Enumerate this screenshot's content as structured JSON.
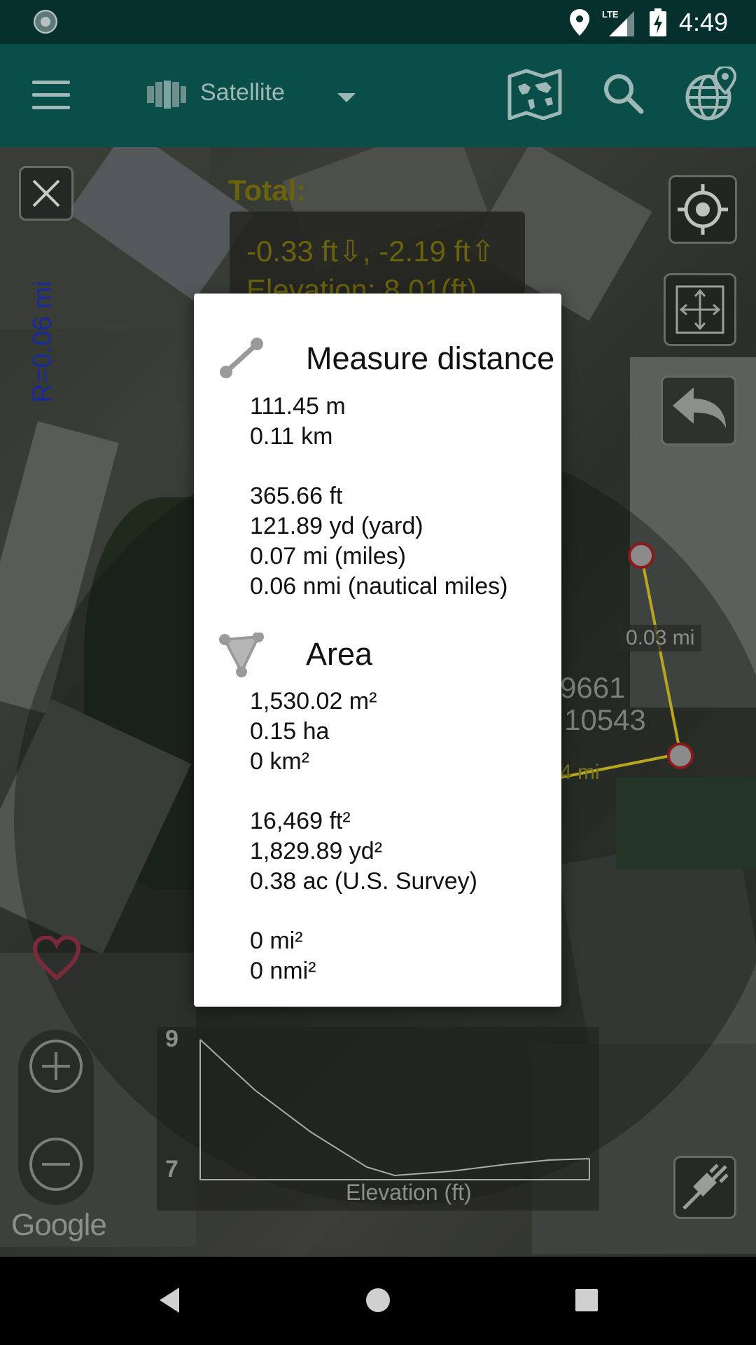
{
  "status_bar": {
    "time": "4:49",
    "network": "LTE",
    "icons": [
      "app-notification-icon",
      "location-icon",
      "signal-icon",
      "battery-charging-icon"
    ]
  },
  "app_bar": {
    "map_type": "Satellite",
    "icons": [
      "menu-icon",
      "layers-icon",
      "world-map-icon",
      "search-icon",
      "globe-location-icon"
    ]
  },
  "map": {
    "radius_label": "R=0.06 mi",
    "total_title": "Total:",
    "total_line1": "-0.33 ft⇩, -2.19 ft⇧",
    "total_line2": "Elevation: 8.01(ft)",
    "segment_label_a": "0.03 mi",
    "segment_label_b": "4 mi",
    "coord_partial_1": "9661",
    "coord_partial_2": "10543",
    "elevation_chart": {
      "y_max": "9",
      "y_min": "7",
      "x_label": "Elevation  (ft)"
    },
    "google_logo": "Google",
    "colors": {
      "route_line": "#b8a620",
      "marker_ring": "#8a1a1a",
      "radius_text": "#1a2a9a"
    }
  },
  "dialog": {
    "distance": {
      "title": "Measure distance",
      "metric": [
        "111.45 m",
        "0.11 km"
      ],
      "imperial": [
        "365.66 ft",
        "121.89 yd (yard)",
        "0.07 mi (miles)",
        "0.06 nmi (nautical miles)"
      ]
    },
    "area": {
      "title": "Area",
      "metric": [
        "1,530.02  m²",
        "0.15 ha",
        "0  km²"
      ],
      "imperial": [
        "16,469  ft²",
        "1,829.89  yd²",
        "0.38 ac (U.S. Survey)"
      ],
      "large": [
        "0  mi²",
        "0  nmi²"
      ]
    }
  },
  "nav_bar": {
    "icons": [
      "back-icon",
      "home-icon",
      "recents-icon"
    ]
  }
}
